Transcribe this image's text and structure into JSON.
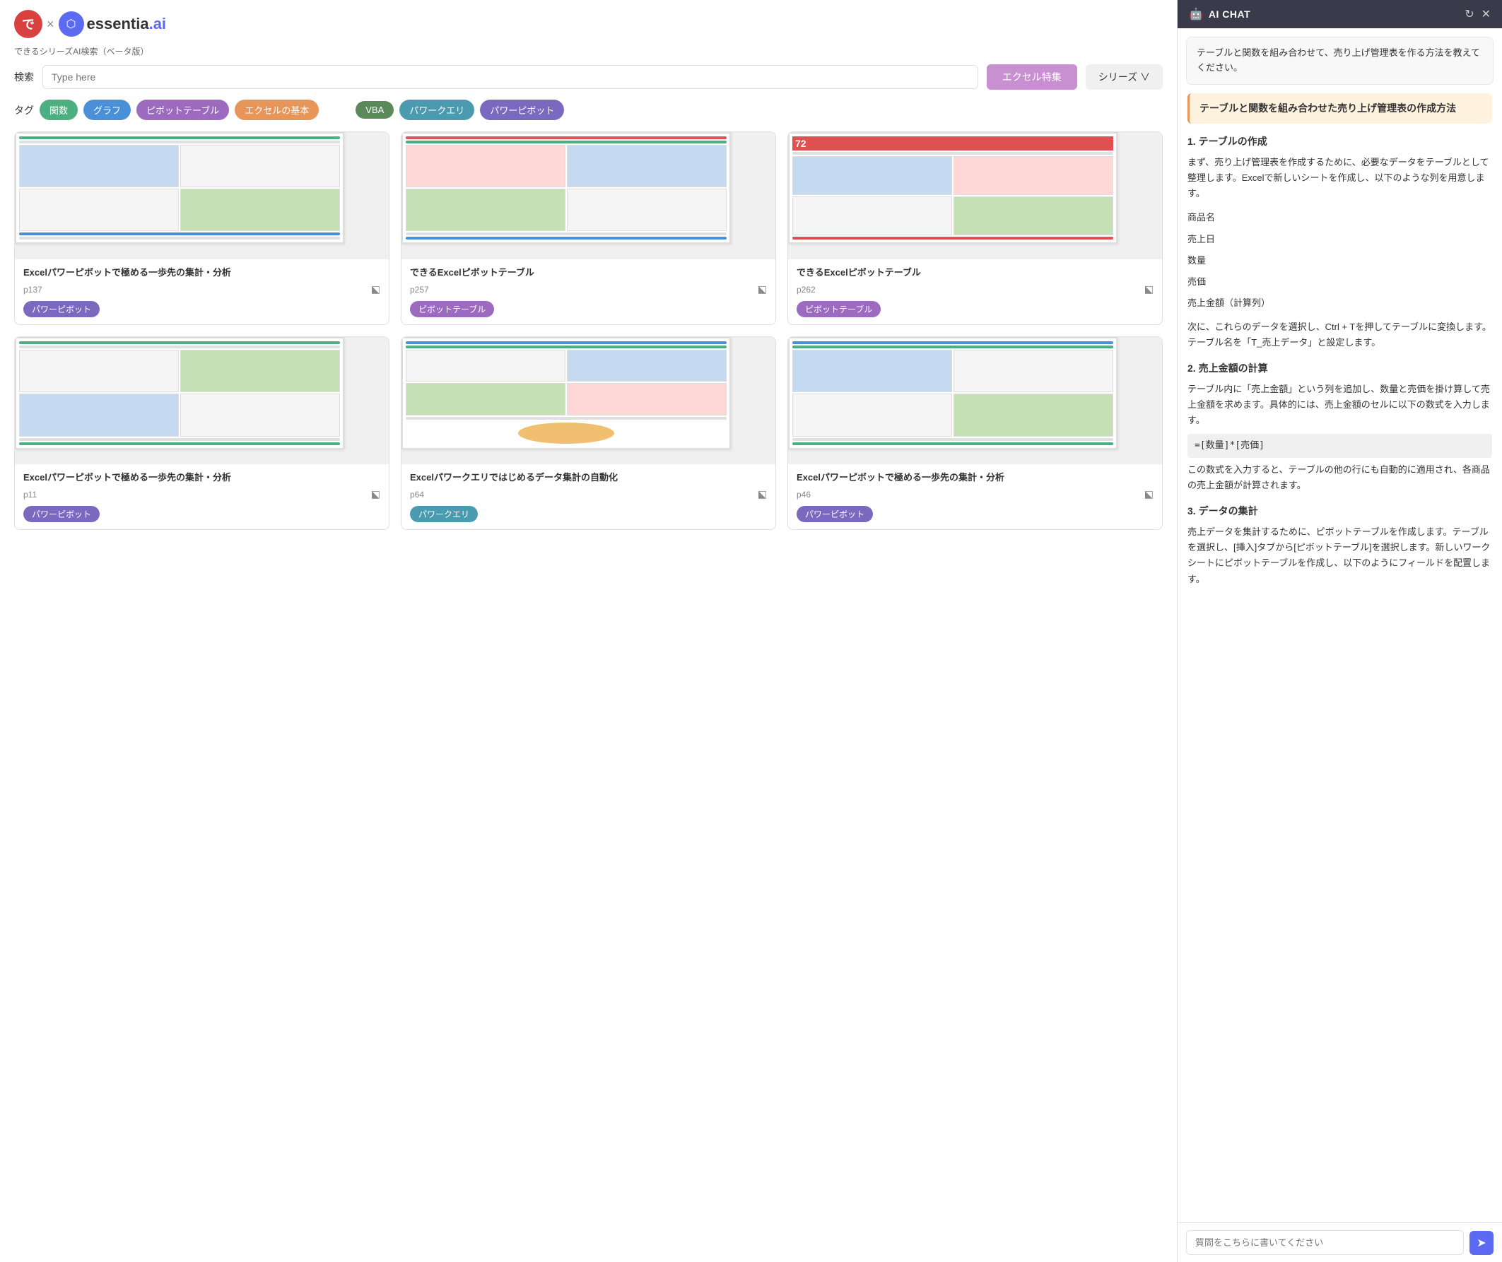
{
  "header": {
    "subtitle": "できるシリーズAI検索（ベータ版）"
  },
  "search": {
    "label": "検索",
    "placeholder": "Type here",
    "filter_label": "エクセル特集",
    "series_label": "シリーズ ∨"
  },
  "tags": {
    "label": "タグ",
    "items": [
      {
        "label": "関数",
        "color": "tag-green"
      },
      {
        "label": "グラフ",
        "color": "tag-blue"
      },
      {
        "label": "ピボットテーブル",
        "color": "tag-purple"
      },
      {
        "label": "エクセルの基本",
        "color": "tag-orange"
      },
      {
        "label": "VBA",
        "color": "tag-darkgreen"
      },
      {
        "label": "パワークエリ",
        "color": "tag-teal"
      },
      {
        "label": "パワーピボット",
        "color": "tag-violet"
      }
    ]
  },
  "cards": [
    {
      "title": "Excelパワーピボットで極める一歩先の集計・分析",
      "page": "p137",
      "tag": "パワーピボット",
      "tag_color": "tag-violet"
    },
    {
      "title": "できるExcelピボットテーブル",
      "page": "p257",
      "tag": "ピボットテーブル",
      "tag_color": "tag-purple"
    },
    {
      "title": "できるExcelピボットテーブル",
      "page": "p262",
      "tag": "ピボットテーブル",
      "tag_color": "tag-purple"
    },
    {
      "title": "Excelパワーピボットで極める一歩先の集計・分析",
      "page": "p11",
      "tag": "パワーピボット",
      "tag_color": "tag-violet"
    },
    {
      "title": "Excelパワークエリではじめるデータ集計の自動化",
      "page": "p64",
      "tag": "パワークエリ",
      "tag_color": "tag-teal"
    },
    {
      "title": "Excelパワーピボットで極める一歩先の集計・分析",
      "page": "p46",
      "tag": "パワーピボット",
      "tag_color": "tag-violet"
    }
  ],
  "chat": {
    "header_title": "AI CHAT",
    "question": "テーブルと関数を組み合わせて、売り上げ管理表を作る方法を教えてください。",
    "answer_title": "テーブルと関数を組み合わせた売り上げ管理表の作成方法",
    "sections": [
      {
        "heading": "1. テーブルの作成",
        "content": "まず、売り上げ管理表を作成するために、必要なデータをテーブルとして整理します。Excelで新しいシートを作成し、以下のような列を用意します。",
        "list": [
          "商品名",
          "売上日",
          "数量",
          "売価",
          "売上金額（計算列）"
        ],
        "extra": "次に、これらのデータを選択し、Ctrl + Tを押してテーブルに変換します。テーブル名を「T_売上データ」と設定します。"
      },
      {
        "heading": "2. 売上金額の計算",
        "content": "テーブル内に「売上金額」という列を追加し、数量と売価を掛け算して売上金額を求めます。具体的には、売上金額のセルに以下の数式を入力します。",
        "formula": "=[数量]*[売価]",
        "extra": "この数式を入力すると、テーブルの他の行にも自動的に適用され、各商品の売上金額が計算されます。"
      },
      {
        "heading": "3. データの集計",
        "content": "売上データを集計するために、ピボットテーブルを作成します。テーブルを選択し、[挿入]タブから[ピボットテーブル]を選択します。新しいワークシートにピボットテーブルを作成し、以下のようにフィールドを配置します。"
      }
    ],
    "input_placeholder": "質問をこちらに書いてください"
  }
}
